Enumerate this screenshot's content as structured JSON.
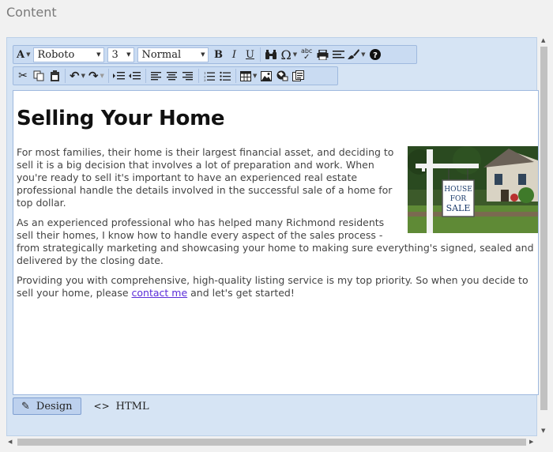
{
  "section": {
    "label": "Content"
  },
  "toolbar": {
    "font_color_label": "A",
    "font_name": "Roboto",
    "font_size": "3",
    "block_format": "Normal",
    "bold": "B",
    "italic": "I",
    "underline": "U",
    "spell_label": "abc"
  },
  "content": {
    "heading": "Selling Your Home",
    "p1": "For most families, their home is their largest financial asset, and deciding to sell it is a big decision that involves a lot of preparation and work. When you're ready to sell it's important to have an experienced real estate professional handle the details involved in the successful sale of a home for top dollar.",
    "p2": "As an experienced professional who has helped many Richmond residents sell their homes, I know how to handle every aspect of the sales process - from strategically marketing and showcasing your home to making sure everything's signed, sealed and delivered by the closing date.",
    "p3_before": "Providing you with comprehensive, high-quality listing service is my top priority. So when you decide to sell your home, please ",
    "p3_link": "contact me",
    "p3_after": " and let's get started!",
    "image_sign": [
      "HOUSE",
      "FOR",
      "SALE"
    ]
  },
  "modes": {
    "design": "Design",
    "html": "HTML"
  }
}
